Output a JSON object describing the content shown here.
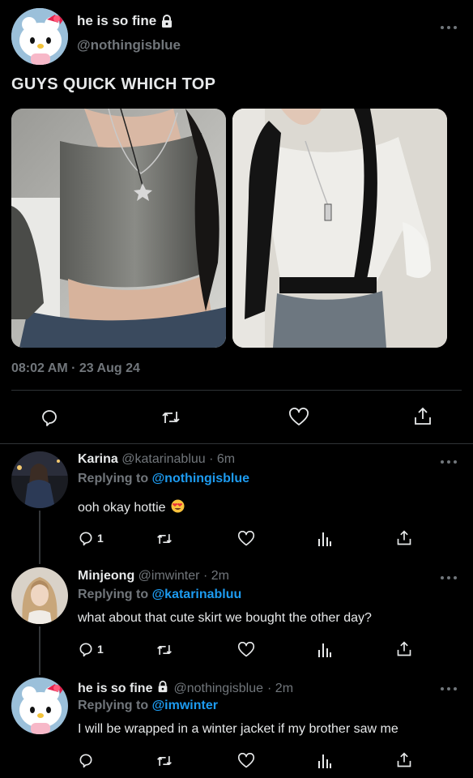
{
  "main_tweet": {
    "display_name": "he is so fine",
    "handle": "@nothingisblue",
    "text": "GUYS QUICK WHICH TOP",
    "timestamp": "08:02 AM · 23 Aug 24",
    "actions": [
      "reply-icon",
      "retweet-icon",
      "like-icon",
      "share-icon"
    ]
  },
  "replies": [
    {
      "display_name": "Karina",
      "handle": "@katarinabluu",
      "time": "· 6m",
      "replying_label": "Replying to",
      "replying_to": "@nothingisblue",
      "text": "ooh okay hottie",
      "emoji": "heart-eyes-emoji",
      "reply_count": "1"
    },
    {
      "display_name": "Minjeong",
      "handle": "@imwinter",
      "time": "· 2m",
      "replying_label": "Replying to",
      "replying_to": "@katarinabluu",
      "text": "what about that cute skirt we bought the other day?",
      "reply_count": "1"
    },
    {
      "display_name": "he is so fine",
      "handle": "@nothingisblue",
      "time": "· 2m",
      "replying_label": "Replying to",
      "replying_to": "@imwinter",
      "text": "I will be wrapped in a winter jacket if my brother saw me",
      "reply_count": ""
    }
  ],
  "colors": {
    "background": "#000000",
    "link": "#1d9bf0",
    "muted": "#71767b",
    "divider": "#2f3336"
  }
}
